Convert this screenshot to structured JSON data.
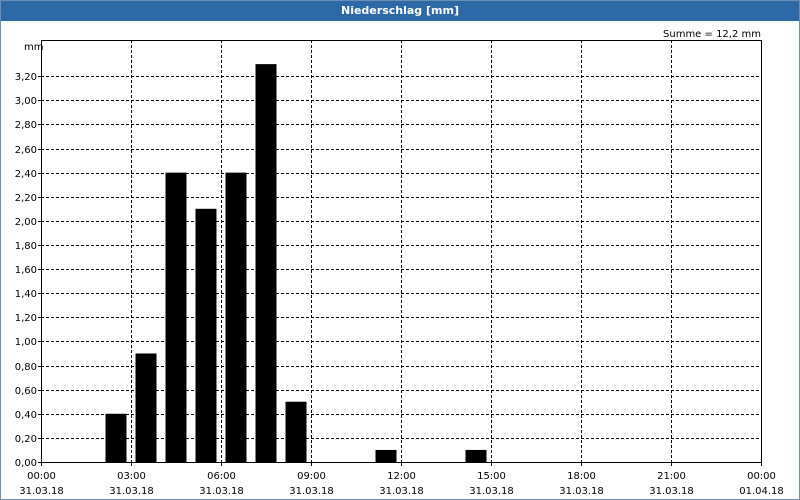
{
  "window": {
    "title": "Niederschlag [mm]"
  },
  "chart_data": {
    "type": "bar",
    "title": "Niederschlag [mm]",
    "unit_label": "mm",
    "summary": "Summe = 12,2 mm",
    "xlabel": "",
    "ylabel": "",
    "ylim": [
      0,
      3.5
    ],
    "y_ticks": [
      0,
      0.2,
      0.4,
      0.6,
      0.8,
      1.0,
      1.2,
      1.4,
      1.6,
      1.8,
      2.0,
      2.2,
      2.4,
      2.6,
      2.8,
      3.0,
      3.2
    ],
    "y_tick_labels": [
      "0,00",
      "0,20",
      "0,40",
      "0,60",
      "0,80",
      "1,00",
      "1,20",
      "1,40",
      "1,60",
      "1,80",
      "2,00",
      "2,20",
      "2,40",
      "2,60",
      "2,80",
      "3,00",
      "3,20"
    ],
    "x_range_hours": [
      0,
      24
    ],
    "x_ticks": [
      {
        "hour": 0,
        "time": "00:00",
        "date": "31.03.18"
      },
      {
        "hour": 3,
        "time": "03:00",
        "date": "31.03.18"
      },
      {
        "hour": 6,
        "time": "06:00",
        "date": "31.03.18"
      },
      {
        "hour": 9,
        "time": "09:00",
        "date": "31.03.18"
      },
      {
        "hour": 12,
        "time": "12:00",
        "date": "31.03.18"
      },
      {
        "hour": 15,
        "time": "15:00",
        "date": "31.03.18"
      },
      {
        "hour": 18,
        "time": "18:00",
        "date": "31.03.18"
      },
      {
        "hour": 21,
        "time": "21:00",
        "date": "31.03.18"
      },
      {
        "hour": 24,
        "time": "00:00",
        "date": "01.04.18"
      }
    ],
    "grid": true,
    "bar_color": "#000000",
    "bars": [
      {
        "hour": 2.5,
        "value": 0.4
      },
      {
        "hour": 3.5,
        "value": 0.9
      },
      {
        "hour": 4.5,
        "value": 2.4
      },
      {
        "hour": 5.5,
        "value": 2.1
      },
      {
        "hour": 6.5,
        "value": 2.4
      },
      {
        "hour": 7.5,
        "value": 3.3
      },
      {
        "hour": 8.5,
        "value": 0.5
      },
      {
        "hour": 11.5,
        "value": 0.1
      },
      {
        "hour": 14.5,
        "value": 0.1
      }
    ]
  }
}
